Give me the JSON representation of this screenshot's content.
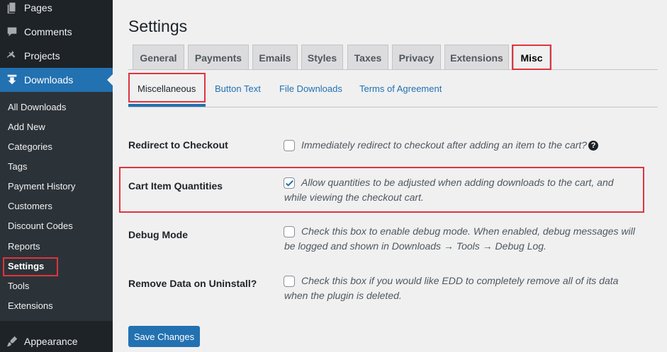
{
  "sidebar": {
    "top_items": [
      {
        "label": "Pages",
        "icon": "pages-icon"
      },
      {
        "label": "Comments",
        "icon": "comments-icon"
      },
      {
        "label": "Projects",
        "icon": "projects-icon"
      },
      {
        "label": "Downloads",
        "icon": "downloads-icon"
      }
    ],
    "sub_items": [
      "All Downloads",
      "Add New",
      "Categories",
      "Tags",
      "Payment History",
      "Customers",
      "Discount Codes",
      "Reports",
      "Settings",
      "Tools",
      "Extensions"
    ],
    "bottom_item": {
      "label": "Appearance",
      "icon": "appearance-icon"
    }
  },
  "page": {
    "title": "Settings"
  },
  "tabs": [
    "General",
    "Payments",
    "Emails",
    "Styles",
    "Taxes",
    "Privacy",
    "Extensions",
    "Misc"
  ],
  "active_tab": "Misc",
  "subtabs": [
    "Miscellaneous",
    "Button Text",
    "File Downloads",
    "Terms of Agreement"
  ],
  "active_subtab": "Miscellaneous",
  "settings": [
    {
      "label": "Redirect to Checkout",
      "checked": false,
      "description": "Immediately redirect to checkout after adding an item to the cart?"
    },
    {
      "label": "Cart Item Quantities",
      "checked": true,
      "description": "Allow quantities to be adjusted when adding downloads to the cart, and while viewing the checkout cart."
    },
    {
      "label": "Debug Mode",
      "checked": false,
      "description": "Check this box to enable debug mode. When enabled, debug messages will be logged and shown in Downloads → Tools → Debug Log."
    },
    {
      "label": "Remove Data on Uninstall?",
      "checked": false,
      "description": "Check this box if you would like EDD to completely remove all of its data when the plugin is deleted."
    }
  ],
  "help_icon_glyph": "?",
  "save_label": "Save Changes",
  "colors": {
    "sidebar_bg": "#1d2327",
    "accent": "#2271b1",
    "highlight": "#e0343d"
  }
}
